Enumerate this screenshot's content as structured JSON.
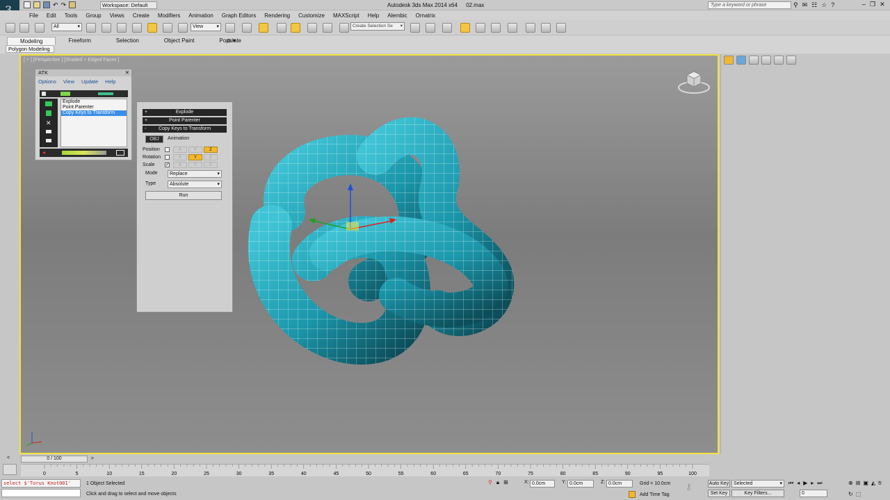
{
  "title_bar": {
    "workspace": "Workspace: Default",
    "app_title": "Autodesk 3ds Max  2014 x64",
    "file_name": "02.max",
    "search_placeholder": "Type a keyword or phrase"
  },
  "menu": [
    "File",
    "Edit",
    "Tools",
    "Group",
    "Views",
    "Create",
    "Modifiers",
    "Animation",
    "Graph Editors",
    "Rendering",
    "Customize",
    "MAXScript",
    "Help",
    "Alembic",
    "Ornatrix"
  ],
  "toolbar": {
    "selection_filter": "All",
    "reference_coord": "View",
    "named_selection_placeholder": "Create Selection Se"
  },
  "ribbon": {
    "tabs": [
      "Modeling",
      "Freeform",
      "Selection",
      "Object Paint",
      "Populate"
    ],
    "sub_tab": "Polygon Modeling"
  },
  "viewport": {
    "label": "[ + ] [Perspective ] [Shaded + Edged Faces ]"
  },
  "atk_panel": {
    "title": "ATK",
    "menu": [
      "Options",
      "View",
      "Update",
      "Help"
    ],
    "tools": [
      "Explode",
      "Point Parenter",
      "Copy Keys to Transform"
    ],
    "selected_index": 2
  },
  "tool_panel": {
    "rollouts": [
      {
        "sign": "+",
        "label": "Explode"
      },
      {
        "sign": "+",
        "label": "Point Parenter"
      },
      {
        "sign": "-",
        "label": "Copy Keys to Transform"
      }
    ],
    "obj_button": "OBJ",
    "obj_label": "Animation",
    "rows": [
      {
        "label": "Position",
        "checked": false,
        "axes": [
          "X",
          "Y",
          "Z"
        ],
        "active": [
          false,
          false,
          true
        ]
      },
      {
        "label": "Rotation",
        "checked": false,
        "axes": [
          "X",
          "Y",
          "Z"
        ],
        "active": [
          false,
          true,
          false
        ]
      },
      {
        "label": "Scale",
        "checked": true,
        "axes": [
          "X",
          "Y",
          "Z"
        ],
        "active": [
          false,
          false,
          false
        ]
      }
    ],
    "mode_label": "Mode",
    "mode_value": "Replace",
    "type_label": "Type",
    "type_value": "Absolute",
    "run_label": "Run"
  },
  "timeline": {
    "frame_counter": "0 / 100",
    "ticks": [
      "0",
      "5",
      "10",
      "15",
      "20",
      "25",
      "30",
      "35",
      "40",
      "45",
      "50",
      "55",
      "60",
      "65",
      "70",
      "75",
      "80",
      "85",
      "90",
      "95",
      "100"
    ]
  },
  "status": {
    "maxscript_listener": "select $'Torus Knot001'",
    "selection_status": "1 Object Selected",
    "prompt": "Click and drag to select and move objects",
    "x_label": "X:",
    "x_value": "0.0cm",
    "y_label": "Y:",
    "y_value": "0.0cm",
    "z_label": "Z:",
    "z_value": "0.0cm",
    "grid": "Grid = 10.0cm",
    "add_time_tag": "Add Time Tag",
    "auto_key": "Auto Key",
    "selected_dropdown": "Selected",
    "set_key": "Set Key",
    "key_filters": "Key Filters...",
    "current_frame": "0"
  },
  "colors": {
    "viewport_border": "#f5e23b",
    "mesh": "#1fa3b8",
    "highlight": "#f2b632",
    "selection_blue": "#3a8ee6"
  }
}
